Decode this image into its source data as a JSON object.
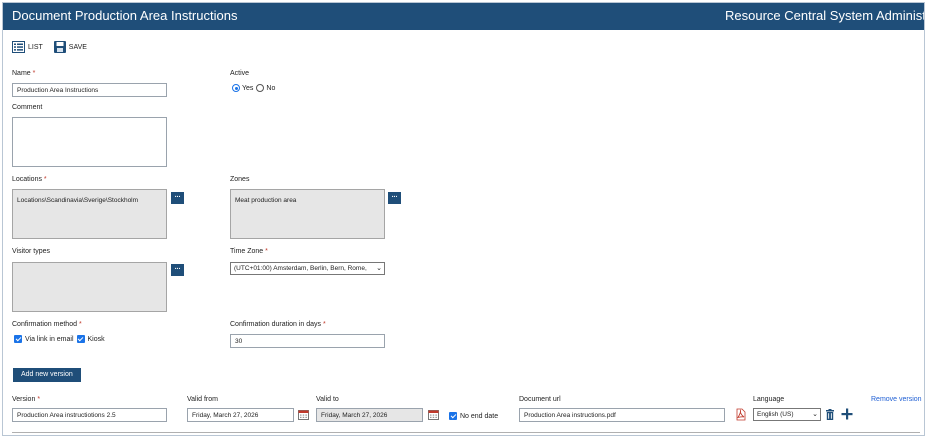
{
  "window": {
    "title": "Document Production Area Instructions",
    "system_name": "Resource Central System Administra"
  },
  "toolbar": {
    "list_label": "LIST",
    "save_label": "SAVE"
  },
  "form": {
    "name": {
      "label": "Name",
      "required": "*",
      "value": "Production Area Instructions"
    },
    "active": {
      "label": "Active",
      "yes_label": "Yes",
      "no_label": "No",
      "selected": "Yes"
    },
    "comment": {
      "label": "Comment",
      "value": ""
    },
    "locations": {
      "label": "Locations",
      "required": "*",
      "value": "Locations\\Scandinavia\\Sverige\\Stockholm",
      "button": "..."
    },
    "zones": {
      "label": "Zones",
      "value": "Meat production area",
      "button": "..."
    },
    "visitor_types": {
      "label": "Visitor types",
      "value": "",
      "button": "..."
    },
    "time_zone": {
      "label": "Time Zone",
      "required": "*",
      "value": "(UTC+01:00) Amsterdam, Berlin, Bern, Rome, "
    },
    "confirmation_method": {
      "label": "Confirmation method",
      "required": "*",
      "option1": "Via link in email",
      "option2": "Kiosk"
    },
    "confirmation_duration": {
      "label": "Confirmation duration in days",
      "required": "*",
      "value": "30"
    }
  },
  "versions": {
    "add_button": "Add new version",
    "remove_link": "Remove version",
    "headers": {
      "version": "Version",
      "version_required": "*",
      "valid_from": "Valid from",
      "valid_to": "Valid to",
      "document_url": "Document url",
      "language": "Language"
    },
    "row": {
      "version": "Production Area instructiotions 2.5",
      "valid_from": "Friday, March 27, 2026",
      "valid_to": "Friday, March 27, 2026",
      "no_end_date": "No end date",
      "document_url": "Production Area instructions.pdf",
      "language": "English (US)"
    }
  },
  "colors": {
    "header_bg": "#1f4e79",
    "accent": "#1a73e8",
    "required": "#c0392b"
  }
}
